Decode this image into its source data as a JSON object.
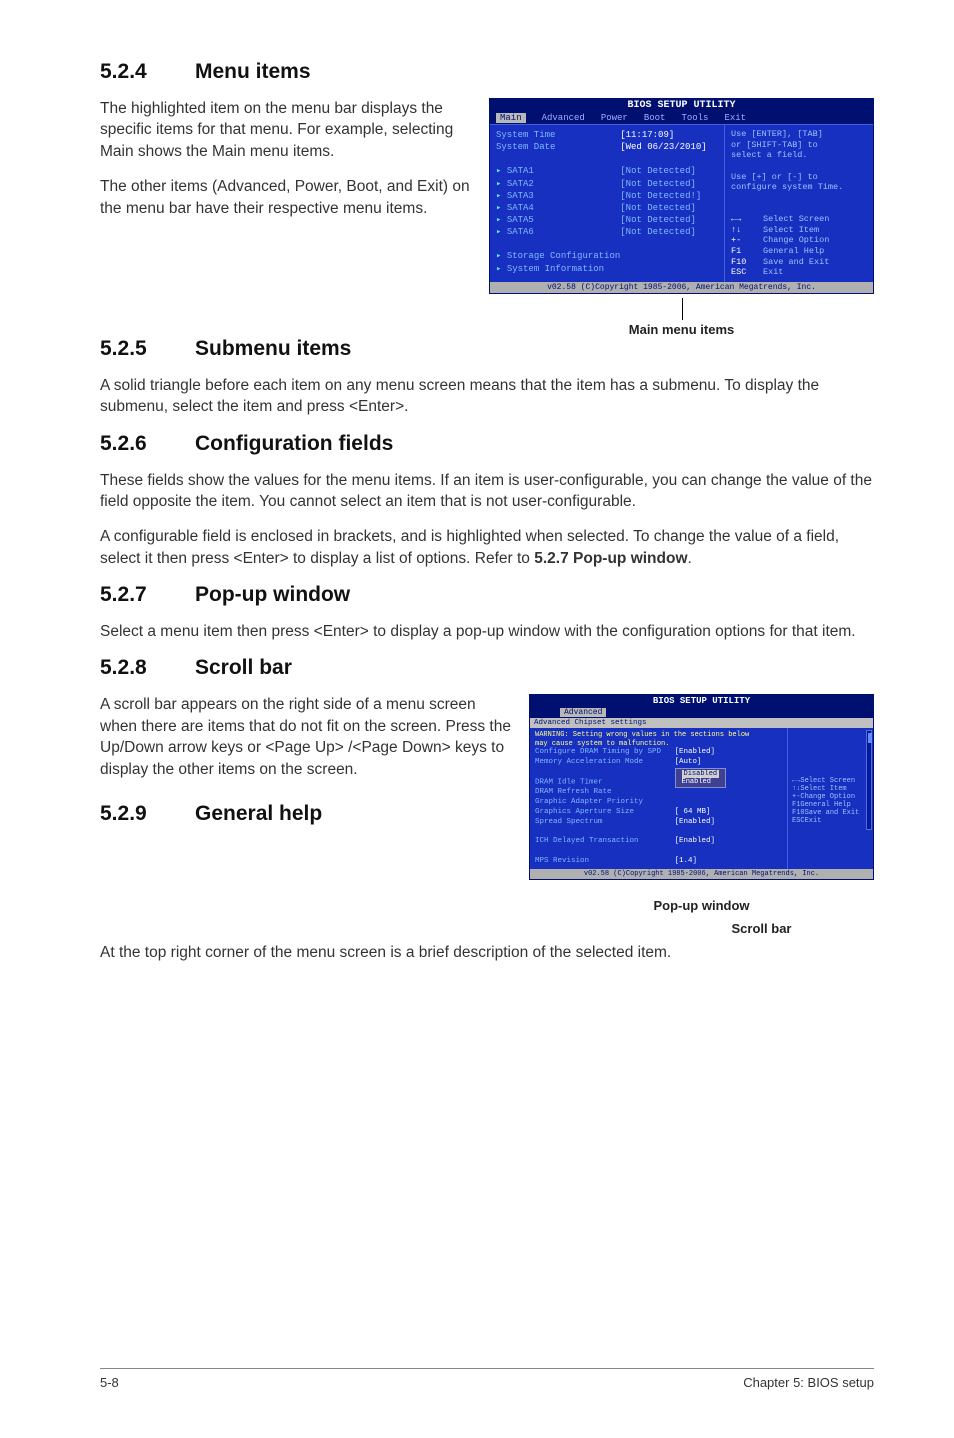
{
  "sections": {
    "s1": {
      "num": "5.2.4",
      "title": "Menu items",
      "p1": "The highlighted item on the menu bar displays the specific items for that menu. For example, selecting Main shows the Main menu items.",
      "p2": "The other items (Advanced, Power, Boot, and Exit) on the menu bar have their respective menu items."
    },
    "s2": {
      "num": "5.2.5",
      "title": "Submenu items",
      "p1": "A solid triangle before each item on any menu screen means that the item has a submenu. To display the submenu, select the item and press <Enter>."
    },
    "s3": {
      "num": "5.2.6",
      "title": "Configuration fields",
      "p1": "These fields show the values for the menu items. If an item is user-configurable, you can change the value of the field opposite the item. You cannot select an item that is not user-configurable.",
      "p2a": "A configurable field is enclosed in brackets, and is highlighted when selected. To change the value of a field, select it then press <Enter> to display a list of options. Refer to ",
      "p2b": "5.2.7 Pop-up window",
      "p2c": "."
    },
    "s4": {
      "num": "5.2.7",
      "title": "Pop-up window",
      "p1": "Select a menu item then press <Enter> to display a pop-up window with the configuration options for that item."
    },
    "s5": {
      "num": "5.2.8",
      "title": "Scroll bar",
      "p1": "A scroll bar appears on the right side of a menu screen when there are items that do not fit on the screen. Press the Up/Down arrow keys or <Page Up> /<Page Down> keys to display the other items on the screen."
    },
    "s6": {
      "num": "5.2.9",
      "title": "General help",
      "p1": "At the top right corner of the menu screen is a brief description of the selected item."
    }
  },
  "bios1": {
    "header": "BIOS SETUP UTILITY",
    "tabs": [
      "Main",
      "Advanced",
      "Power",
      "Boot",
      "Tools",
      "Exit"
    ],
    "selected_tab": "Main",
    "rows": {
      "systime": "System Time",
      "systime_val": "[11:17:09]",
      "sysdate": "System Date",
      "sysdate_val": "[Wed 06/23/2010]",
      "sata1": "SATA1",
      "sata2": "SATA2",
      "sata3": "SATA3",
      "sata4": "SATA4",
      "sata5": "SATA5",
      "sata6": "SATA6",
      "notdet": "[Not Detected]",
      "notdet2": "[Not Detected!]",
      "stor": "Storage Configuration",
      "sysinfo": "System Information"
    },
    "help": {
      "l1": "Use [ENTER], [TAB]",
      "l2": "or [SHIFT-TAB] to",
      "l3": "select a field.",
      "l4": "Use [+] or [-] to",
      "l5": "configure system Time.",
      "k1": "←→",
      "d1": "Select Screen",
      "k2": "↑↓",
      "d2": "Select Item",
      "k3": "+-",
      "d3": "Change Option",
      "k4": "F1",
      "d4": "General Help",
      "k5": "F10",
      "d5": "Save and Exit",
      "k6": "ESC",
      "d6": "Exit"
    },
    "footer": "v02.58 (C)Copyright 1985-2006, American Megatrends, Inc.",
    "caption": "Main menu items"
  },
  "bios2": {
    "header": "BIOS SETUP UTILITY",
    "tab": "Advanced",
    "subheading": "Advanced Chipset settings",
    "warn1": "WARNING: Setting wrong values in the sections below",
    "warn2": "         may cause system to malfunction.",
    "rows": {
      "r1": "Configure DRAM Timing by SPD",
      "r1v": "[Enabled]",
      "r2": "Memory Acceleration Mode",
      "r2v": "[Auto]",
      "r3": "DRAM Idle Timer",
      "r4": "DRAM Refresh Rate",
      "r5": "Graphic Adapter Priority",
      "r6": "Graphics Aperture Size",
      "r6v": "[ 64 MB]",
      "r7": "Spread Spectrum",
      "r7v": "[Enabled]",
      "r8": "ICH Delayed Transaction",
      "r8v": "[Enabled]",
      "r9": "MPS Revision",
      "r9v": "[1.4]"
    },
    "popup": {
      "opt1": "Disabled",
      "opt2": "Enabled"
    },
    "help": {
      "k1": "←→",
      "d1": "Select Screen",
      "k2": "↑↓",
      "d2": "Select Item",
      "k3": "+-",
      "d3": "Change Option",
      "k4": "F1",
      "d4": "General Help",
      "k5": "F10",
      "d5": "Save and Exit",
      "k6": "ESC",
      "d6": "Exit"
    },
    "footer": "v02.58 (C)Copyright 1985-2006, American Megatrends, Inc.",
    "caption_popup": "Pop-up window",
    "caption_scroll": "Scroll bar"
  },
  "pagefooter": {
    "left": "5-8",
    "right": "Chapter 5: BIOS setup"
  }
}
